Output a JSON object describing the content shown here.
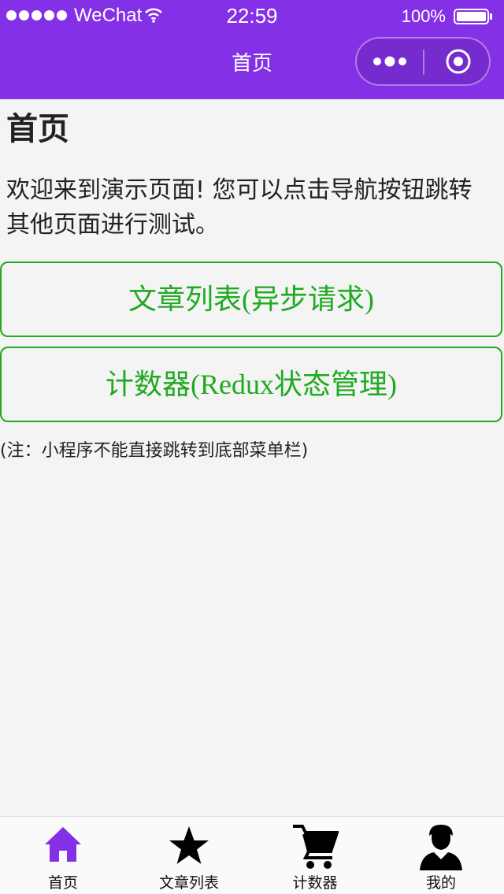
{
  "status_bar": {
    "carrier": "WeChat",
    "time": "22:59",
    "battery": "100%"
  },
  "nav_bar": {
    "title": "首页",
    "more_icon": "more-dots-icon",
    "close_icon": "close-miniprogram-icon"
  },
  "main": {
    "heading": "首页",
    "intro": "欢迎来到演示页面! 您可以点击导航按钮跳转其他页面进行测试。",
    "buttons": [
      {
        "label": "文章列表(异步请求)"
      },
      {
        "label": "计数器(Redux状态管理)"
      }
    ],
    "note": "(注：小程序不能直接跳转到底部菜单栏)"
  },
  "tab_bar": {
    "items": [
      {
        "label": "首页",
        "icon": "home-icon",
        "active": true
      },
      {
        "label": "文章列表",
        "icon": "star-icon",
        "active": false
      },
      {
        "label": "计数器",
        "icon": "cart-icon",
        "active": false
      },
      {
        "label": "我的",
        "icon": "user-icon",
        "active": false
      }
    ]
  },
  "colors": {
    "header": "#8430e6",
    "accent_green": "#1faa21",
    "tab_active": "#8430e6",
    "background": "#f4f4f4"
  }
}
